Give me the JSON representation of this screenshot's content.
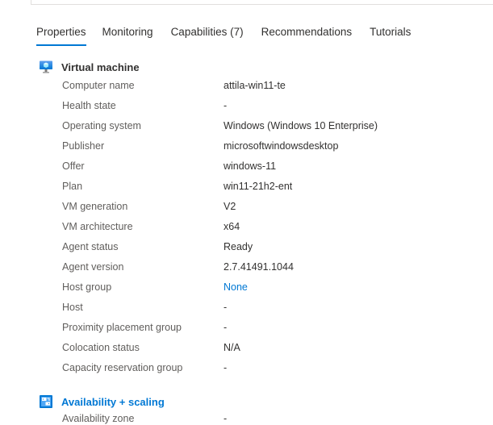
{
  "tabs": [
    {
      "label": "Properties",
      "active": true
    },
    {
      "label": "Monitoring",
      "active": false
    },
    {
      "label": "Capabilities (7)",
      "active": false
    },
    {
      "label": "Recommendations",
      "active": false
    },
    {
      "label": "Tutorials",
      "active": false
    }
  ],
  "vm_section": {
    "title": "Virtual machine",
    "icon": "monitor-icon",
    "rows": [
      {
        "label": "Computer name",
        "value": "attila-win11-te"
      },
      {
        "label": "Health state",
        "value": "-"
      },
      {
        "label": "Operating system",
        "value": "Windows (Windows 10 Enterprise)"
      },
      {
        "label": "Publisher",
        "value": "microsoftwindowsdesktop"
      },
      {
        "label": "Offer",
        "value": "windows-11"
      },
      {
        "label": "Plan",
        "value": "win11-21h2-ent"
      },
      {
        "label": "VM generation",
        "value": "V2"
      },
      {
        "label": "VM architecture",
        "value": "x64"
      },
      {
        "label": "Agent status",
        "value": "Ready"
      },
      {
        "label": "Agent version",
        "value": "2.7.41491.1044"
      },
      {
        "label": "Host group",
        "value": "None",
        "link": true
      },
      {
        "label": "Host",
        "value": "-"
      },
      {
        "label": "Proximity placement group",
        "value": "-"
      },
      {
        "label": "Colocation status",
        "value": "N/A"
      },
      {
        "label": "Capacity reservation group",
        "value": "-"
      }
    ]
  },
  "availability_section": {
    "title": "Availability + scaling",
    "icon": "scale-set-icon",
    "rows": [
      {
        "label": "Availability zone",
        "value": "-"
      }
    ]
  },
  "colors": {
    "accent": "#0078d4",
    "label": "#605e5c",
    "text": "#323130"
  }
}
